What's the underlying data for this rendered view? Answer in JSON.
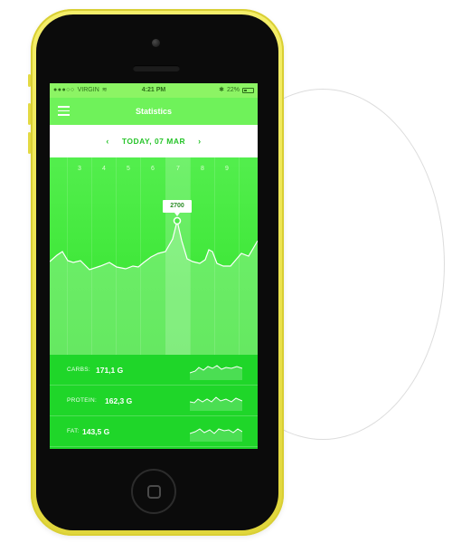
{
  "status_bar": {
    "carrier": "VIRGIN",
    "time": "4:21 PM",
    "battery": "22%"
  },
  "nav": {
    "title": "Statistics"
  },
  "date_picker": {
    "label": "TODAY, 07 MAR"
  },
  "chart": {
    "days": [
      "3",
      "4",
      "5",
      "6",
      "7",
      "8",
      "9"
    ],
    "selected_day": "7",
    "tooltip_value": "2700"
  },
  "stats": [
    {
      "label": "CARBS:",
      "value": "171,1 G"
    },
    {
      "label": "PROTEIN:",
      "value": "162,3 G"
    },
    {
      "label": "FAT:",
      "value": "143,5 G"
    }
  ],
  "colors": {
    "phone_body": "#f2ec62",
    "screen_green": "#1fd629",
    "chart_green": "#53ee4d",
    "accent_text": "#27c42a"
  }
}
